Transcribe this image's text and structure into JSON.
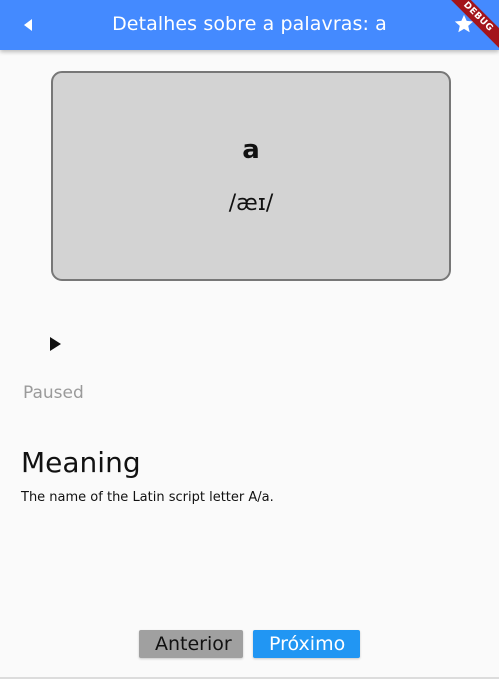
{
  "app_bar": {
    "title": "Detalhes sobre a palavras: a",
    "back_icon": "back-arrow-icon",
    "star_icon": "star-icon",
    "debug_label": "DEBUG",
    "color": "#448aff"
  },
  "card": {
    "word": "a",
    "phonetic": "/æɪ/",
    "background": "#d3d3d3"
  },
  "player": {
    "play_icon": "play-icon",
    "status": "Paused"
  },
  "meaning": {
    "heading": "Meaning",
    "text": "The name of the Latin script letter A/a."
  },
  "navigation": {
    "previous_label": "Anterior",
    "next_label": "Próximo",
    "next_color": "#2196f3",
    "previous_color": "#a0a0a0"
  }
}
